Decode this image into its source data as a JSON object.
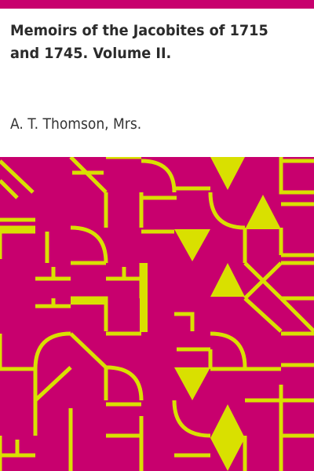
{
  "book": {
    "title": "Memoirs of the Jacobites of 1715 and 1745. Volume II.",
    "author": "A. T. Thomson, Mrs."
  },
  "colors": {
    "background": "#ffffff",
    "accent": "#c8006e",
    "pattern": "#d9e000",
    "title_text": "#2b2b2b"
  }
}
